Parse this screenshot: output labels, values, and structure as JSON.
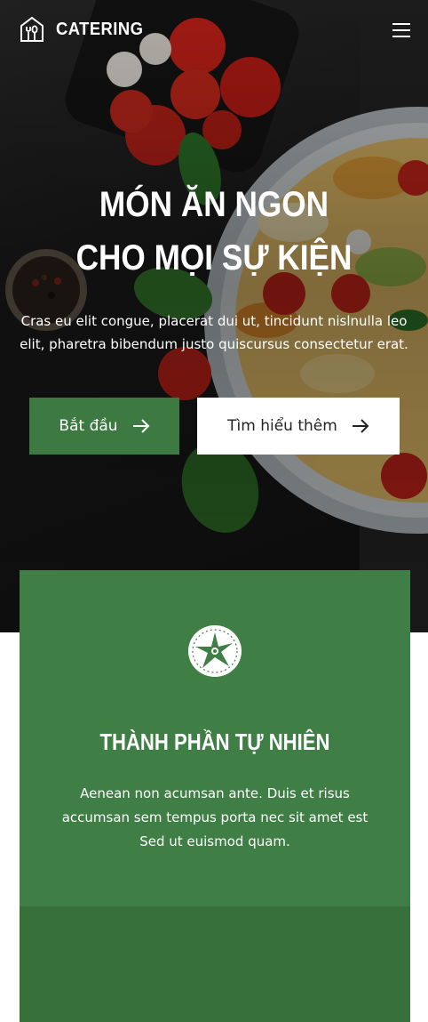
{
  "header": {
    "logo_text": "CATERING"
  },
  "hero": {
    "title_line1": "MÓN ĂN NGON",
    "title_line2": "CHO MỌI SỰ KIỆN",
    "subtitle": "Cras eu elit congue, placerat dui ut, tincidunt nislnulla leo elit, pharetra bibendum justo quiscursus consectetur erat.",
    "primary_button": "Bắt đầu",
    "secondary_button": "Tìm hiểu thêm"
  },
  "feature": {
    "title": "THÀNH PHẦN TỰ NHIÊN",
    "text": "Aenean non acumsan ante. Duis et risus accumsan sem tempus porta nec sit amet est Sed ut euismod quam."
  },
  "colors": {
    "accent_green": "#3d7a42",
    "card_green": "#3f7e44",
    "card_green_dark": "#387039",
    "hero_dark": "#1a1a1a"
  }
}
